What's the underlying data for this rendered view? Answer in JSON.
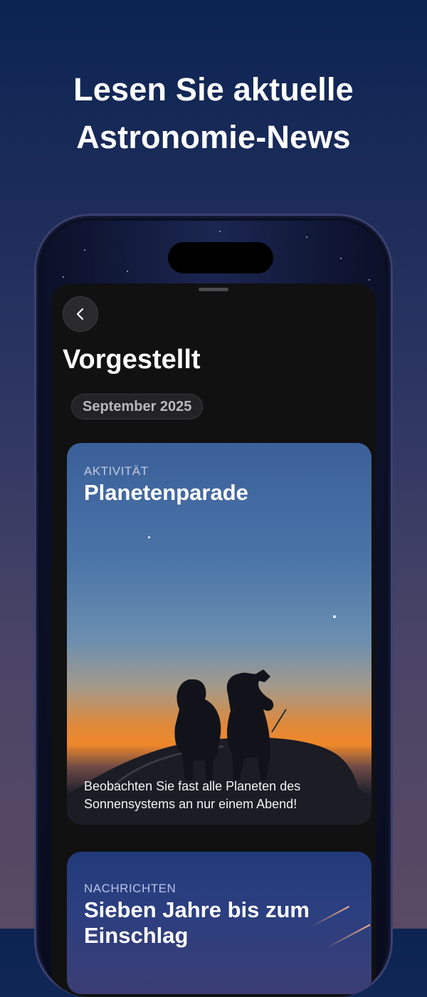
{
  "headline": {
    "line1": "Lesen Sie aktuelle",
    "line2": "Astronomie-News"
  },
  "screen": {
    "title": "Vorgestellt",
    "date_filter": "September 2025",
    "cards": [
      {
        "category": "AKTIVITÄT",
        "title": "Planetenparade",
        "description_line1": "Beobachten Sie fast alle Planeten des",
        "description_line2": "Sonnensystems an nur einem Abend!"
      },
      {
        "category": "NACHRICHTEN",
        "title": "Sieben Jahre bis zum Einschlag"
      }
    ]
  },
  "icons": {
    "back": "chevron-left-icon"
  },
  "colors": {
    "sheet_background": "#111112",
    "pill_text": "#b9b9bd",
    "category_text": "#c3cbe0"
  }
}
